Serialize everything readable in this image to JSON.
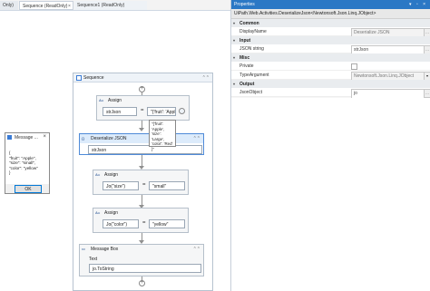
{
  "tabs": [
    {
      "label": "Only)"
    },
    {
      "label": "Sequence (ReadOnly)"
    },
    {
      "label": "Sequence1 (ReadOnly)"
    }
  ],
  "tab_close_glyph": "×",
  "sequence": {
    "title": "Sequence",
    "add_glyph": "+",
    "collapse_glyph": "⌃⌃",
    "activities": [
      {
        "title": "Assign",
        "to": "strJson",
        "value": "\"{'fruit': 'Apple'"
      },
      {
        "title": "Deserialize JSON",
        "input": "strJson"
      },
      {
        "title": "Assign",
        "to": "Jo(\"size\")",
        "value": "\"small\""
      },
      {
        "title": "Assign",
        "to": "Jo(\"color\")",
        "value": "\"yellow\""
      },
      {
        "title": "Message Box",
        "field_label": "Text",
        "text": "jo.ToString"
      }
    ]
  },
  "tooltip": {
    "lines": [
      "\"{'fruit': 'Apple',",
      "'size': 'Large',",
      "'color': 'Red'",
      "}\""
    ]
  },
  "message_box": {
    "title": "Message ...",
    "close_glyph": "×",
    "body_lines": [
      "{",
      "\"fruit\": \"Apple\",",
      "\"size\": \"small\",",
      "\"color\": \"yellow\"",
      "}"
    ],
    "ok_label": "OK"
  },
  "properties": {
    "title": "Properties",
    "title_controls": "▾ ▫ ×",
    "type_name": "UiPath.Web.Activities.DeserializeJson<Newtonsoft.Json.Linq.JObject>",
    "categories": [
      {
        "name": "Common",
        "rows": [
          {
            "name": "DisplayName",
            "value": "Deserialize JSON"
          }
        ]
      },
      {
        "name": "Input",
        "rows": [
          {
            "name": "JSON string",
            "value": "strJson"
          }
        ]
      },
      {
        "name": "Misc",
        "rows": [
          {
            "name": "Private",
            "value": ""
          },
          {
            "name": "TypeArgument",
            "value": "Newtonsoft.Json.Linq.JObject"
          }
        ]
      },
      {
        "name": "Output",
        "rows": [
          {
            "name": "JsonObject",
            "value": "jo"
          }
        ]
      }
    ]
  }
}
